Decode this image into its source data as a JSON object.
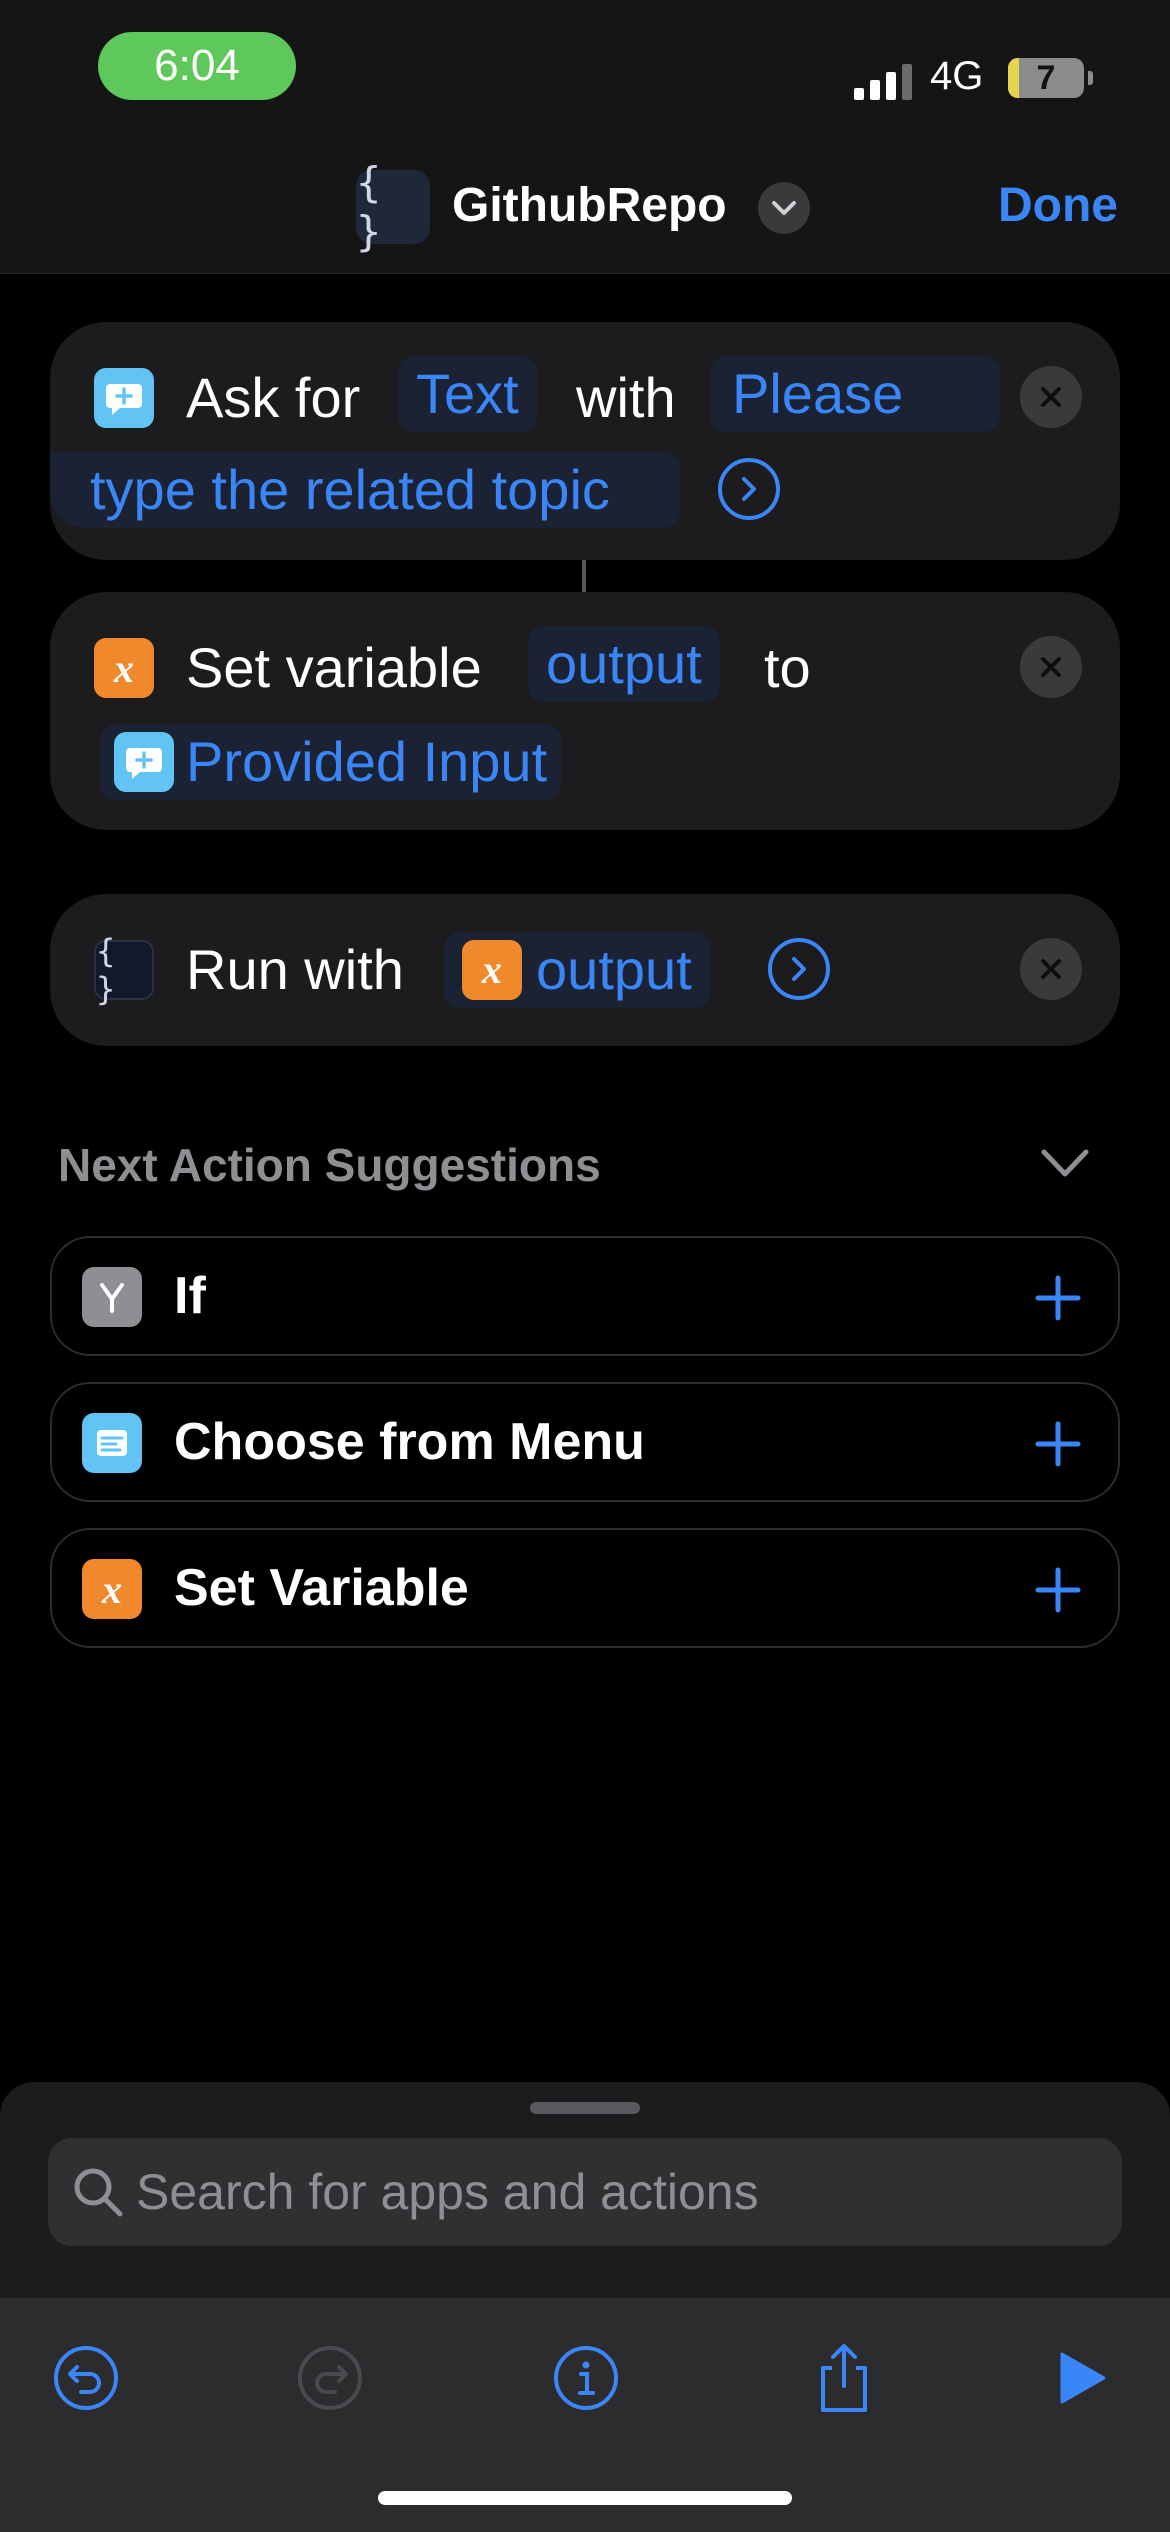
{
  "status_bar": {
    "time": "6:04",
    "network": "4G",
    "battery": "7",
    "battery_level_percent": 7
  },
  "nav": {
    "icon": "braces-icon",
    "icon_glyph": "{ }",
    "title": "GithubRepo",
    "done_label": "Done"
  },
  "actions": {
    "ask": {
      "verb": "Ask for",
      "type_token": "Text",
      "with": "with",
      "prompt_line1": "Please",
      "prompt_line2": "type the related topic"
    },
    "set_var": {
      "verb": "Set variable",
      "var_name": "output",
      "to": "to",
      "value": "Provided Input"
    },
    "run": {
      "verb": "Run with",
      "var_name": "output",
      "icon_glyph": "{ }",
      "var_glyph": "x"
    }
  },
  "suggestions": {
    "header": "Next Action Suggestions",
    "items": [
      {
        "label": "If",
        "icon": "branch-icon",
        "color": "#8e8e93"
      },
      {
        "label": "Choose from Menu",
        "icon": "menu-icon",
        "color": "#62c3f5"
      },
      {
        "label": "Set Variable",
        "icon": "variable-icon",
        "color": "#f0892c",
        "glyph": "x"
      }
    ]
  },
  "search": {
    "placeholder": "Search for apps and actions"
  },
  "colors": {
    "accent": "#3a86f7",
    "time_pill": "#5fc85b",
    "card": "#1c1c1e"
  }
}
